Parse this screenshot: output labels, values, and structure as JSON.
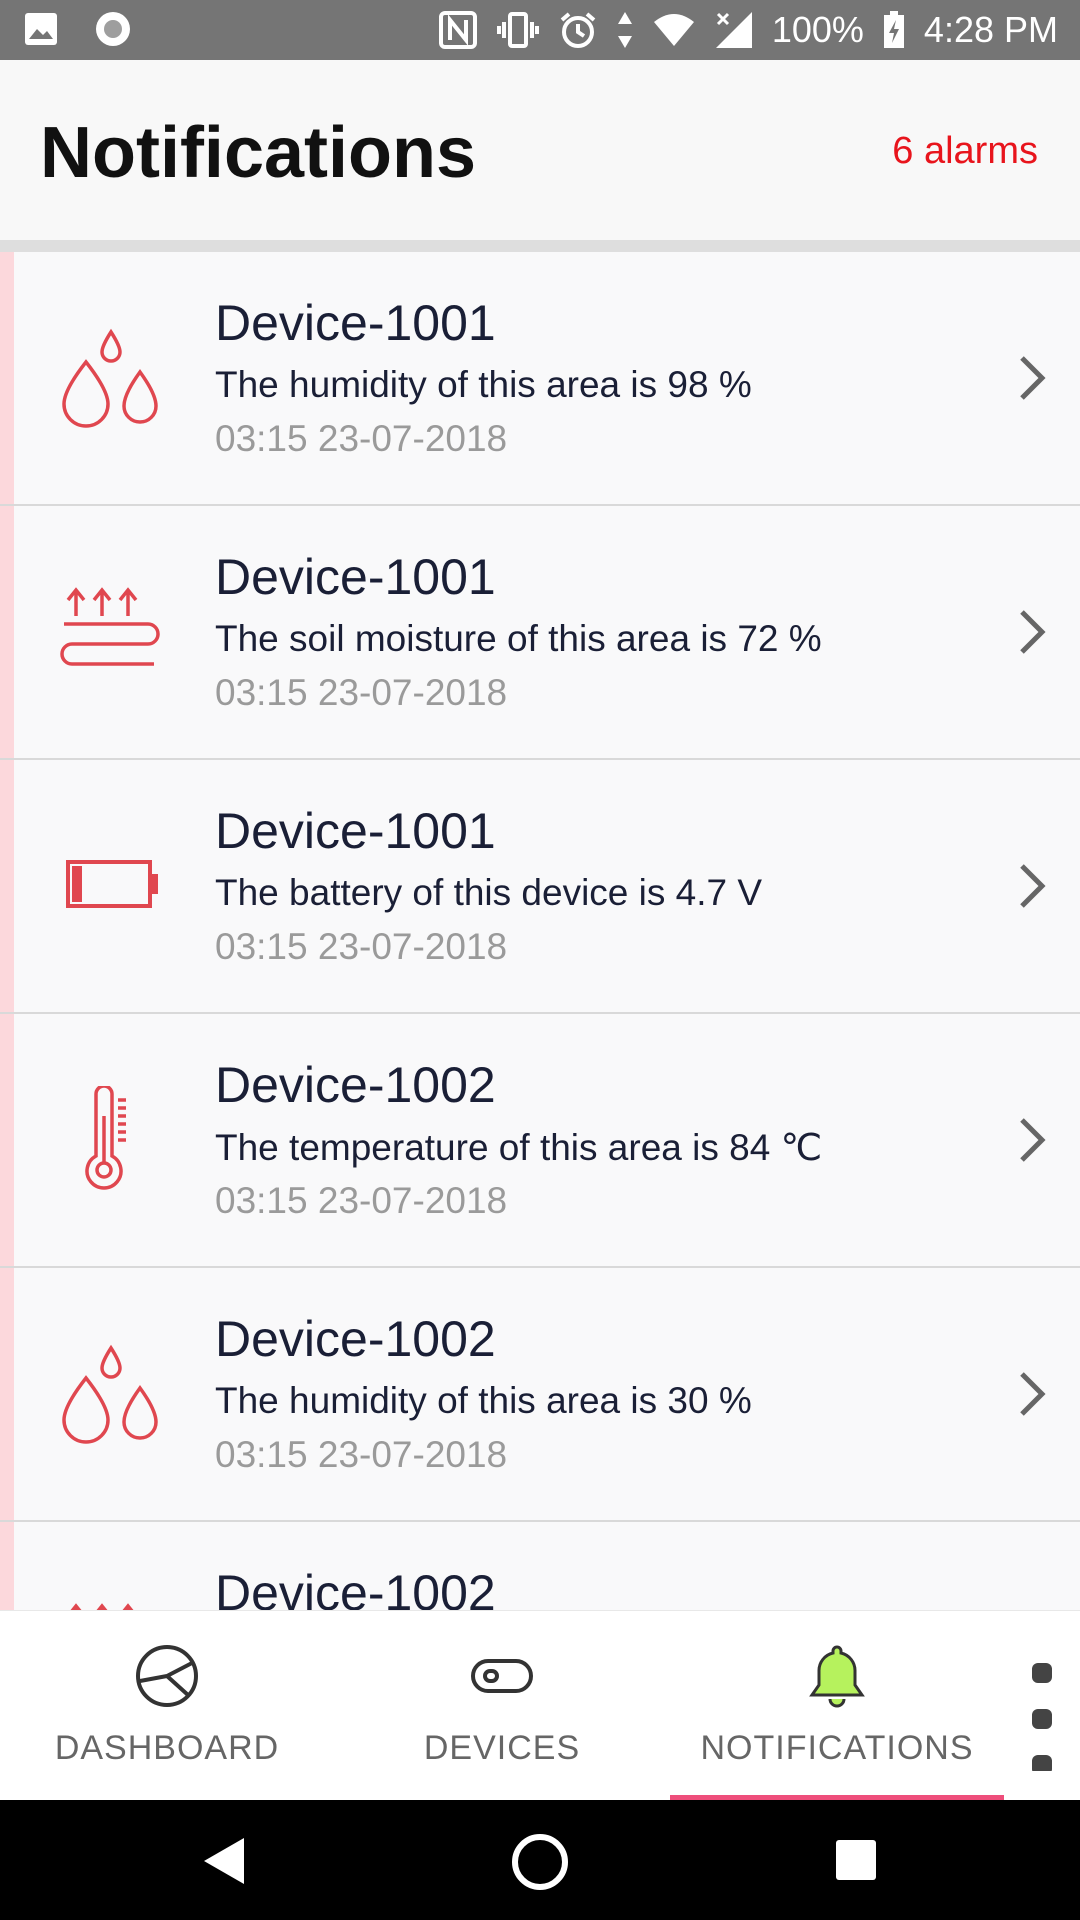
{
  "status_bar": {
    "battery": "100%",
    "time": "4:28 PM"
  },
  "header": {
    "title": "Notifications",
    "alarm_count": "6 alarms"
  },
  "notifications": [
    {
      "device": "Device-1001",
      "message": "The humidity of this area is 98 %",
      "time": "03:15  23-07-2018",
      "icon": "humidity-icon"
    },
    {
      "device": "Device-1001",
      "message": "The soil moisture of this area is 72 %",
      "time": "03:15  23-07-2018",
      "icon": "soil-moisture-icon"
    },
    {
      "device": "Device-1001",
      "message": "The battery of this device is 4.7 V",
      "time": "03:15  23-07-2018",
      "icon": "battery-icon"
    },
    {
      "device": "Device-1002",
      "message": "The temperature of this area is 84 ℃",
      "time": "03:15  23-07-2018",
      "icon": "thermometer-icon"
    },
    {
      "device": "Device-1002",
      "message": "The humidity of this area is 30 %",
      "time": "03:15  23-07-2018",
      "icon": "humidity-icon"
    },
    {
      "device": "Device-1002",
      "message": "",
      "time": "",
      "icon": "soil-moisture-icon"
    }
  ],
  "bottom_nav": {
    "tabs": [
      {
        "label": "DASHBOARD",
        "icon": "dashboard-icon"
      },
      {
        "label": "DEVICES",
        "icon": "devices-icon"
      },
      {
        "label": "NOTIFICATIONS",
        "icon": "bell-icon",
        "active": true
      }
    ]
  },
  "colors": {
    "alarm_text": "#e8141c",
    "icon_red": "#e0474f",
    "active_underline": "#ee4e7b",
    "bell_fill": "#b6f25d",
    "row_accent": "#fcd8dc"
  }
}
